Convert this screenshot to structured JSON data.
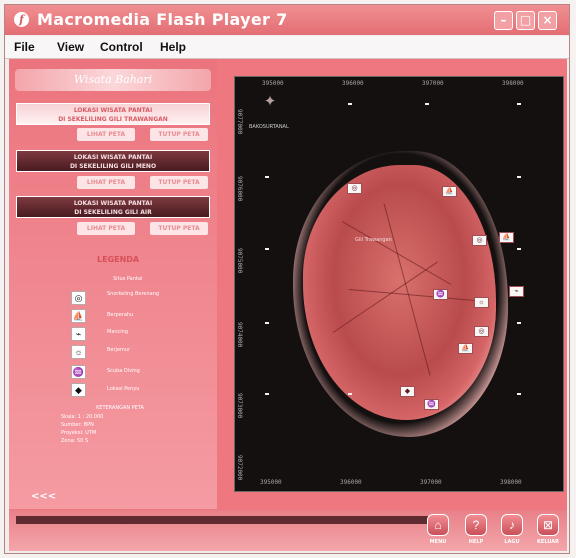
{
  "window": {
    "title": "Macromedia Flash Player 7",
    "icon": "flash-icon",
    "controls": [
      "minimize-icon",
      "maximize-icon",
      "close-icon"
    ]
  },
  "menu": {
    "items": [
      "File",
      "View",
      "Control",
      "Help"
    ]
  },
  "left_panel": {
    "header": "Wisata Bahari",
    "sections": [
      {
        "title_line1": "LOKASI WISATA PANTAI",
        "title_line2": "DI SEKELILING GILI TRAWANGAN",
        "view_button": "LIHAT PETA",
        "close_button": "TUTUP PETA"
      },
      {
        "title_line1": "LOKASI WISATA PANTAI",
        "title_line2": "DI SEKELILING GILI MENO",
        "view_button": "LIHAT PETA",
        "close_button": "TUTUP PETA"
      },
      {
        "title_line1": "LOKASI WISATA PANTAI",
        "title_line2": "DI SEKELILING GILI AIR",
        "view_button": "LIHAT PETA",
        "close_button": "TUTUP PETA"
      }
    ],
    "legend": {
      "title": "LEGENDA",
      "subtitle": "Situs Pantai",
      "items": [
        {
          "icon": "snorkel-icon",
          "label": "Snorkeling Berenang"
        },
        {
          "icon": "boat-icon",
          "label": "Berperahu"
        },
        {
          "icon": "fishing-icon",
          "label": "Mancing"
        },
        {
          "icon": "sunbathing-icon",
          "label": "Berjemur"
        },
        {
          "icon": "diving-icon",
          "label": "Scuba Diving"
        },
        {
          "icon": "turtle-icon",
          "label": "Lokasi Penyu"
        }
      ]
    },
    "map_info": {
      "title": "KETERANGAN PETA",
      "lines": [
        "Skala: 1 : 20.000",
        "Sumber: BPN",
        "Proyeksi: UTM",
        "Zona: 50 S"
      ]
    },
    "back_label": "<<<"
  },
  "map": {
    "top_ticks": [
      "395000",
      "396000",
      "397000",
      "398000"
    ],
    "side_ticks": [
      "9077000",
      "9076000",
      "9075000",
      "9074000",
      "9073000",
      "9072000"
    ],
    "bottom_ticks": [
      "395000",
      "396000",
      "397000",
      "398000"
    ],
    "logo_text": "BAKOSURTANAL",
    "place_label": "Gili Trawangan"
  },
  "bottom_nav": [
    {
      "icon": "home-icon",
      "label": "MENU"
    },
    {
      "icon": "help-icon",
      "label": "HELP"
    },
    {
      "icon": "music-icon",
      "label": "LAGU"
    },
    {
      "icon": "exit-icon",
      "label": "KELUAR"
    }
  ]
}
